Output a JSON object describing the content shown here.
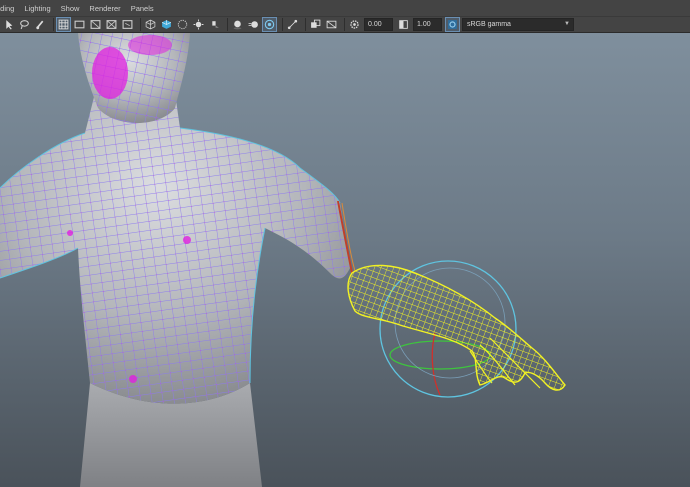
{
  "menubar": {
    "items": [
      "ading",
      "Lighting",
      "Show",
      "Renderer",
      "Panels"
    ]
  },
  "toolbar": {
    "exposure_value": "0.00",
    "gamma_value": "1.00",
    "color_space": "sRGB gamma",
    "icons": [
      "select-icon",
      "lasso-icon",
      "paint-icon",
      "grid-icon",
      "film-gate-icon",
      "resolution-gate-icon",
      "safe-area-icon",
      "field-chart-icon",
      "camera-icon",
      "wireframe-icon",
      "smooth-shade-icon",
      "textured-icon",
      "lighting-icon",
      "shadows-icon",
      "ambient-occlusion-icon",
      "motion-blur-icon",
      "xray-icon",
      "xray-joints-icon",
      "isolate-icon",
      "exposure-icon",
      "gamma-icon",
      "color-management-icon"
    ]
  },
  "viewport": {
    "background_top": "#7f8f9d",
    "background_bottom": "#4a525a",
    "mesh_color": "#9c8cff",
    "vertex_color": "#e020e0",
    "selection_color": "#f2f224",
    "manipulator_ring": "#5fc4e0"
  }
}
